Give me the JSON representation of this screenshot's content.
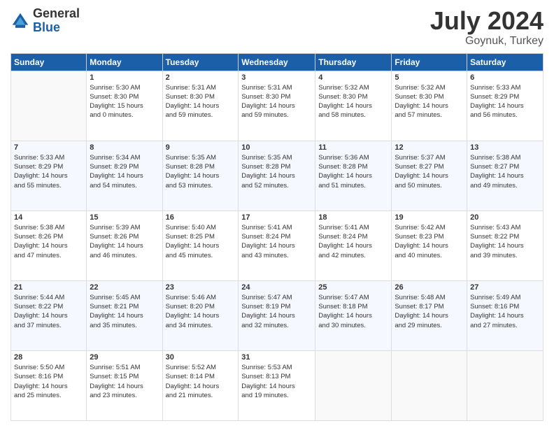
{
  "header": {
    "logo_general": "General",
    "logo_blue": "Blue",
    "month": "July 2024",
    "location": "Goynuk, Turkey"
  },
  "days_of_week": [
    "Sunday",
    "Monday",
    "Tuesday",
    "Wednesday",
    "Thursday",
    "Friday",
    "Saturday"
  ],
  "weeks": [
    [
      {
        "day": "",
        "info": ""
      },
      {
        "day": "1",
        "info": "Sunrise: 5:30 AM\nSunset: 8:30 PM\nDaylight: 15 hours\nand 0 minutes."
      },
      {
        "day": "2",
        "info": "Sunrise: 5:31 AM\nSunset: 8:30 PM\nDaylight: 14 hours\nand 59 minutes."
      },
      {
        "day": "3",
        "info": "Sunrise: 5:31 AM\nSunset: 8:30 PM\nDaylight: 14 hours\nand 59 minutes."
      },
      {
        "day": "4",
        "info": "Sunrise: 5:32 AM\nSunset: 8:30 PM\nDaylight: 14 hours\nand 58 minutes."
      },
      {
        "day": "5",
        "info": "Sunrise: 5:32 AM\nSunset: 8:30 PM\nDaylight: 14 hours\nand 57 minutes."
      },
      {
        "day": "6",
        "info": "Sunrise: 5:33 AM\nSunset: 8:29 PM\nDaylight: 14 hours\nand 56 minutes."
      }
    ],
    [
      {
        "day": "7",
        "info": "Sunrise: 5:33 AM\nSunset: 8:29 PM\nDaylight: 14 hours\nand 55 minutes."
      },
      {
        "day": "8",
        "info": "Sunrise: 5:34 AM\nSunset: 8:29 PM\nDaylight: 14 hours\nand 54 minutes."
      },
      {
        "day": "9",
        "info": "Sunrise: 5:35 AM\nSunset: 8:28 PM\nDaylight: 14 hours\nand 53 minutes."
      },
      {
        "day": "10",
        "info": "Sunrise: 5:35 AM\nSunset: 8:28 PM\nDaylight: 14 hours\nand 52 minutes."
      },
      {
        "day": "11",
        "info": "Sunrise: 5:36 AM\nSunset: 8:28 PM\nDaylight: 14 hours\nand 51 minutes."
      },
      {
        "day": "12",
        "info": "Sunrise: 5:37 AM\nSunset: 8:27 PM\nDaylight: 14 hours\nand 50 minutes."
      },
      {
        "day": "13",
        "info": "Sunrise: 5:38 AM\nSunset: 8:27 PM\nDaylight: 14 hours\nand 49 minutes."
      }
    ],
    [
      {
        "day": "14",
        "info": "Sunrise: 5:38 AM\nSunset: 8:26 PM\nDaylight: 14 hours\nand 47 minutes."
      },
      {
        "day": "15",
        "info": "Sunrise: 5:39 AM\nSunset: 8:26 PM\nDaylight: 14 hours\nand 46 minutes."
      },
      {
        "day": "16",
        "info": "Sunrise: 5:40 AM\nSunset: 8:25 PM\nDaylight: 14 hours\nand 45 minutes."
      },
      {
        "day": "17",
        "info": "Sunrise: 5:41 AM\nSunset: 8:24 PM\nDaylight: 14 hours\nand 43 minutes."
      },
      {
        "day": "18",
        "info": "Sunrise: 5:41 AM\nSunset: 8:24 PM\nDaylight: 14 hours\nand 42 minutes."
      },
      {
        "day": "19",
        "info": "Sunrise: 5:42 AM\nSunset: 8:23 PM\nDaylight: 14 hours\nand 40 minutes."
      },
      {
        "day": "20",
        "info": "Sunrise: 5:43 AM\nSunset: 8:22 PM\nDaylight: 14 hours\nand 39 minutes."
      }
    ],
    [
      {
        "day": "21",
        "info": "Sunrise: 5:44 AM\nSunset: 8:22 PM\nDaylight: 14 hours\nand 37 minutes."
      },
      {
        "day": "22",
        "info": "Sunrise: 5:45 AM\nSunset: 8:21 PM\nDaylight: 14 hours\nand 35 minutes."
      },
      {
        "day": "23",
        "info": "Sunrise: 5:46 AM\nSunset: 8:20 PM\nDaylight: 14 hours\nand 34 minutes."
      },
      {
        "day": "24",
        "info": "Sunrise: 5:47 AM\nSunset: 8:19 PM\nDaylight: 14 hours\nand 32 minutes."
      },
      {
        "day": "25",
        "info": "Sunrise: 5:47 AM\nSunset: 8:18 PM\nDaylight: 14 hours\nand 30 minutes."
      },
      {
        "day": "26",
        "info": "Sunrise: 5:48 AM\nSunset: 8:17 PM\nDaylight: 14 hours\nand 29 minutes."
      },
      {
        "day": "27",
        "info": "Sunrise: 5:49 AM\nSunset: 8:16 PM\nDaylight: 14 hours\nand 27 minutes."
      }
    ],
    [
      {
        "day": "28",
        "info": "Sunrise: 5:50 AM\nSunset: 8:16 PM\nDaylight: 14 hours\nand 25 minutes."
      },
      {
        "day": "29",
        "info": "Sunrise: 5:51 AM\nSunset: 8:15 PM\nDaylight: 14 hours\nand 23 minutes."
      },
      {
        "day": "30",
        "info": "Sunrise: 5:52 AM\nSunset: 8:14 PM\nDaylight: 14 hours\nand 21 minutes."
      },
      {
        "day": "31",
        "info": "Sunrise: 5:53 AM\nSunset: 8:13 PM\nDaylight: 14 hours\nand 19 minutes."
      },
      {
        "day": "",
        "info": ""
      },
      {
        "day": "",
        "info": ""
      },
      {
        "day": "",
        "info": ""
      }
    ]
  ]
}
